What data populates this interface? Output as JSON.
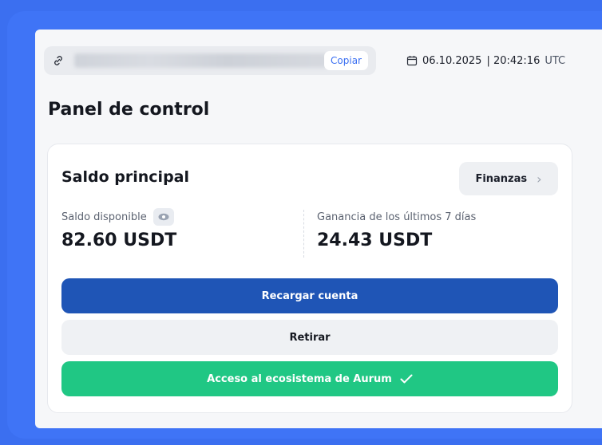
{
  "topbar": {
    "copy_label": "Copiar",
    "date": "06.10.2025",
    "time": "| 20:42:16",
    "tz": "UTC",
    "icons": [
      "link-icon",
      "calendar-icon"
    ]
  },
  "page_title": "Panel de control",
  "balance_panel": {
    "title": "Saldo principal",
    "finance_button": "Finanzas",
    "available": {
      "label": "Saldo disponible",
      "value": "82.60 USDT"
    },
    "earnings": {
      "label": "Ganancia de los últimos 7 días",
      "value": "24.43 USDT"
    }
  },
  "actions": {
    "recharge": "Recargar cuenta",
    "withdraw": "Retirar",
    "ecosystem": "Acceso al ecosistema de Aurum"
  },
  "colors": {
    "background": "#3b6ff0",
    "primary": "#1f55b6",
    "success": "#20c784",
    "link": "#3a6ff2"
  }
}
